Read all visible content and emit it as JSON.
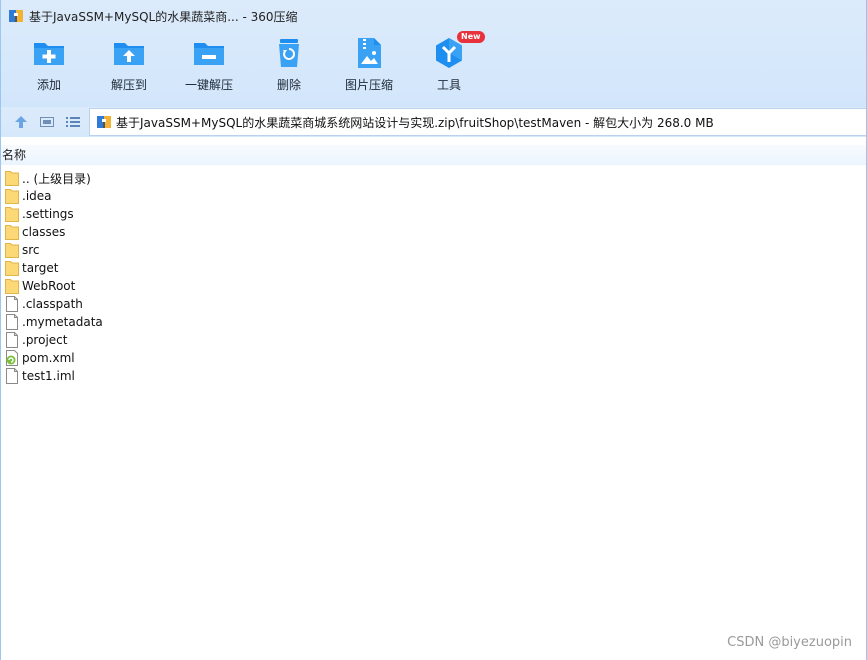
{
  "window": {
    "title": "基于JavaSSM+MySQL的水果蔬菜商... - 360压缩",
    "app_icon": "archive-icon"
  },
  "toolbar": {
    "items": [
      {
        "label": "添加",
        "icon": "add-folder-icon"
      },
      {
        "label": "解压到",
        "icon": "extract-to-icon"
      },
      {
        "label": "一键解压",
        "icon": "one-click-extract-icon"
      },
      {
        "label": "删除",
        "icon": "recycle-bin-icon"
      },
      {
        "label": "图片压缩",
        "icon": "image-compress-icon"
      },
      {
        "label": "工具",
        "icon": "tools-icon",
        "badge": "New"
      }
    ]
  },
  "nav": {
    "up_icon": "up-arrow-icon",
    "view_icon": "thumbnail-view-icon",
    "list_icon": "list-view-icon",
    "path": "基于JavaSSM+MySQL的水果蔬菜商城系统网站设计与实现.zip\\fruitShop\\testMaven - 解包大小为 268.0 MB"
  },
  "list": {
    "column_name": "名称",
    "rows": [
      {
        "name": ".. (上级目录)",
        "icon": "folder-icon"
      },
      {
        "name": ".idea",
        "icon": "folder-icon"
      },
      {
        "name": ".settings",
        "icon": "folder-icon"
      },
      {
        "name": "classes",
        "icon": "folder-icon"
      },
      {
        "name": "src",
        "icon": "folder-icon"
      },
      {
        "name": "target",
        "icon": "folder-icon"
      },
      {
        "name": "WebRoot",
        "icon": "folder-icon"
      },
      {
        "name": ".classpath",
        "icon": "file-icon"
      },
      {
        "name": ".mymetadata",
        "icon": "file-icon"
      },
      {
        "name": ".project",
        "icon": "file-icon"
      },
      {
        "name": "pom.xml",
        "icon": "xml-file-icon"
      },
      {
        "name": "test1.iml",
        "icon": "file-icon"
      }
    ]
  },
  "watermark": "CSDN @biyezuopin",
  "colors": {
    "toolbar_bg": "#d6e8fb",
    "icon_blue": "#1e8ff0",
    "folder_yellow": "#fcd876",
    "badge_red": "#e8313b"
  }
}
